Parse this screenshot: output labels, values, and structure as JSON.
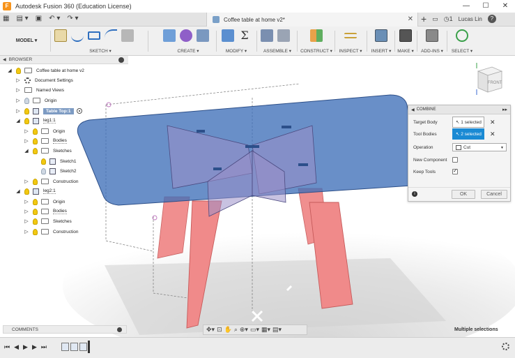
{
  "window": {
    "title": "Autodesk Fusion 360 (Education License)",
    "controls": [
      "—",
      "☐",
      "✕"
    ]
  },
  "tabs": {
    "document": "Coffee table at home v2*",
    "user": "Lucas Lin",
    "notifications": "1"
  },
  "toolbar": {
    "workspace": "MODEL ▾",
    "groups": [
      "SKETCH ▾",
      "CREATE ▾",
      "MODIFY ▾",
      "ASSEMBLE ▾",
      "CONSTRUCT ▾",
      "INSPECT ▾",
      "INSERT ▾",
      "MAKE ▾",
      "ADD-INS ▾",
      "SELECT ▾"
    ]
  },
  "browser": {
    "header": "BROWSER",
    "items": [
      {
        "label": "Coffee table at home v2"
      },
      {
        "label": "Document Settings"
      },
      {
        "label": "Named Views"
      },
      {
        "label": "Origin"
      },
      {
        "label": "Table Top:1"
      },
      {
        "label": "leg1:1"
      },
      {
        "label": "Origin"
      },
      {
        "label": "Bodies"
      },
      {
        "label": "Sketches"
      },
      {
        "label": "Sketch1"
      },
      {
        "label": "Sketch2"
      },
      {
        "label": "Construction"
      },
      {
        "label": "leg2:1"
      },
      {
        "label": "Origin"
      },
      {
        "label": "Bodies"
      },
      {
        "label": "Sketches"
      },
      {
        "label": "Construction"
      }
    ]
  },
  "viewcube": {
    "face": "FRONT"
  },
  "combine": {
    "title": "COMBINE",
    "target_body_label": "Target Body",
    "target_body_value": "1 selected",
    "tool_bodies_label": "Tool Bodies",
    "tool_bodies_value": "2 selected",
    "operation_label": "Operation",
    "operation_value": "Cut",
    "new_component_label": "New Component",
    "new_component_checked": false,
    "keep_tools_label": "Keep Tools",
    "keep_tools_checked": true,
    "ok": "OK",
    "cancel": "Cancel"
  },
  "comments": {
    "label": "COMMENTS"
  },
  "status": {
    "text": "Multiple selections"
  },
  "colors": {
    "tabletop": "#3f6fb8",
    "legs": "#f08a8a",
    "accent": "#1a8ad4"
  }
}
